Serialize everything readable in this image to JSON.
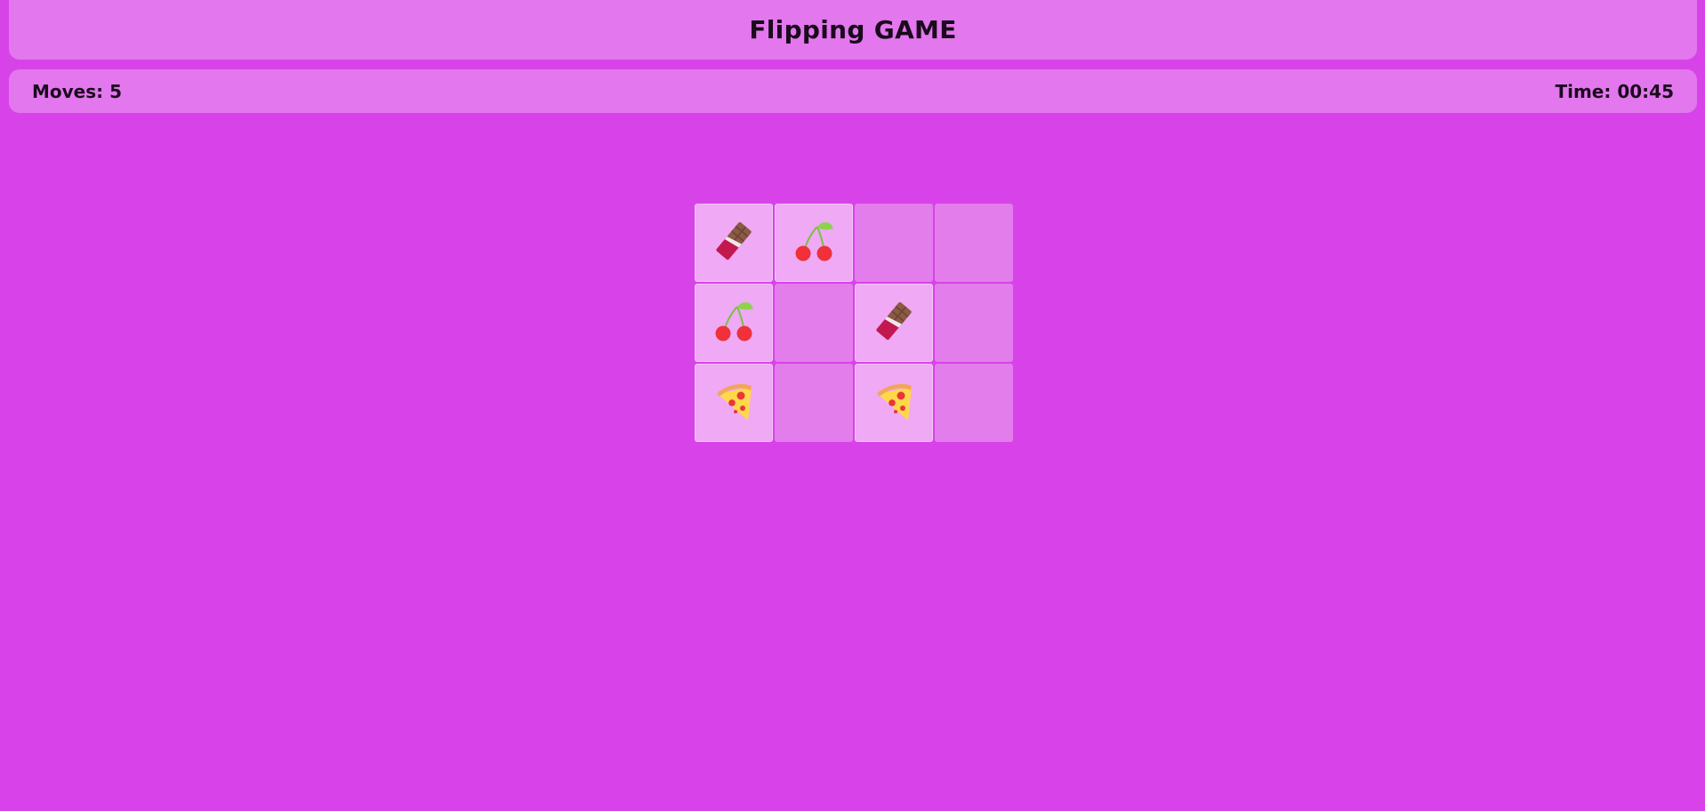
{
  "header": {
    "title": "Flipping GAME"
  },
  "stats": {
    "moves_label": "Moves:",
    "moves_value": "5",
    "time_label": "Time:",
    "time_value": "00:45"
  },
  "board": {
    "columns": 4,
    "rows": 3,
    "cards": [
      {
        "icon": "chocolate-icon",
        "face_up": true
      },
      {
        "icon": "cherries-icon",
        "face_up": true
      },
      {
        "icon": null,
        "face_up": false
      },
      {
        "icon": null,
        "face_up": false
      },
      {
        "icon": "cherries-icon",
        "face_up": true
      },
      {
        "icon": null,
        "face_up": false
      },
      {
        "icon": "chocolate-icon",
        "face_up": true
      },
      {
        "icon": null,
        "face_up": false
      },
      {
        "icon": "pizza-icon",
        "face_up": true
      },
      {
        "icon": null,
        "face_up": false
      },
      {
        "icon": "pizza-icon",
        "face_up": true
      },
      {
        "icon": null,
        "face_up": false
      }
    ]
  },
  "colors": {
    "background": "#d843e9",
    "panel": "#e377ee",
    "card_face_down": "#e37deb",
    "card_face_up": "#efa9f5"
  }
}
